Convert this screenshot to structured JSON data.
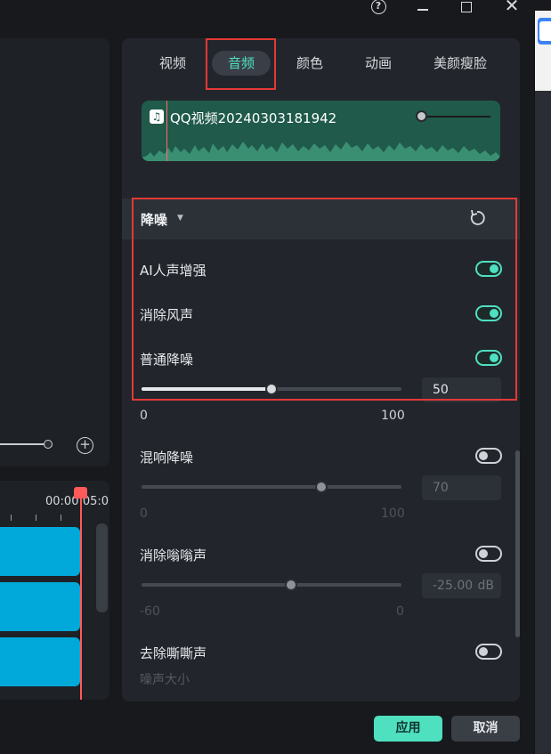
{
  "window": {
    "help": "?",
    "close": "✕"
  },
  "preview": {
    "zoom_plus": "+"
  },
  "timeline": {
    "timecode": "00:00:05:0"
  },
  "tabs": [
    {
      "label": "视频",
      "active": false
    },
    {
      "label": "音频",
      "active": true
    },
    {
      "label": "颜色",
      "active": false
    },
    {
      "label": "动画",
      "active": false
    },
    {
      "label": "美颜瘦脸",
      "active": false
    }
  ],
  "audio_clip": {
    "music_icon": "♫",
    "name": "QQ视频20240303181942"
  },
  "denoise": {
    "title": "降噪",
    "caret": "▼",
    "ai_voice": {
      "label": "AI人声增强",
      "on": true
    },
    "wind": {
      "label": "消除风声",
      "on": true
    },
    "normal": {
      "label": "普通降噪",
      "on": true,
      "value": "50",
      "min": "0",
      "max": "100",
      "fraction": 0.5
    },
    "reverb": {
      "label": "混响降噪",
      "on": false,
      "value": "70",
      "min": "0",
      "max": "100",
      "fraction": 0.7
    },
    "hum": {
      "label": "消除嗡嗡声",
      "on": false,
      "value": "-25.00",
      "unit": "dB",
      "min": "-60",
      "max": "0",
      "fraction": 0.58
    },
    "hiss": {
      "label": "去除嘶嘶声",
      "on": false
    },
    "noise_level": {
      "label": "噪声大小"
    }
  },
  "buttons": {
    "apply": "应用",
    "cancel": "取消"
  },
  "colors": {
    "accent": "#4fe0c0",
    "highlight": "#e53935",
    "clip_blue": "#00a9d9",
    "playhead": "#ff5a5a"
  }
}
